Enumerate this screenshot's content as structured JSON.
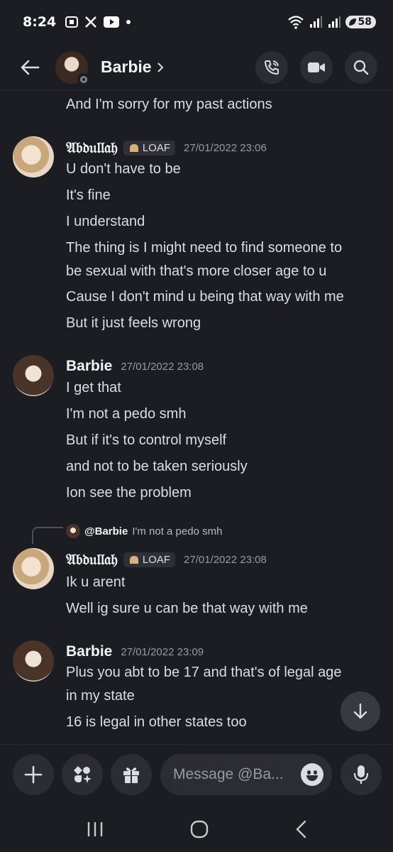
{
  "status_bar": {
    "time": "8:24",
    "battery": "58"
  },
  "header": {
    "contact_name": "Barbie"
  },
  "messages": {
    "prev_line": "And I'm sorry for my past actions",
    "group1": {
      "author": "𝔄𝔟𝔡𝔲𝔩𝔩𝔞𝔥",
      "tag": "LOAF",
      "timestamp": "27/01/2022 23:06",
      "lines": [
        "U don't have to be",
        "It's fine",
        "I understand",
        "The thing is I might need to find someone to",
        "be sexual with that's more closer age to u",
        "Cause I don't mind u being that way with me",
        "But it just feels wrong"
      ]
    },
    "group2": {
      "author": "Barbie",
      "timestamp": "27/01/2022 23:08",
      "lines": [
        "I get that",
        "I'm not a pedo smh",
        "But if it's to control myself",
        "and not to be taken seriously",
        "Ion see the problem"
      ]
    },
    "reply": {
      "name": "@Barbie",
      "text": "I'm not a pedo smh"
    },
    "group3": {
      "author": "𝔄𝔟𝔡𝔲𝔩𝔩𝔞𝔥",
      "tag": "LOAF",
      "timestamp": "27/01/2022 23:08",
      "lines": [
        "Ik u arent",
        "Well ig sure u can be that way with me"
      ]
    },
    "group4": {
      "author": "Barbie",
      "timestamp": "27/01/2022 23:09",
      "lines": [
        "Plus you abt to be 17 and that's of legal age",
        "in my state",
        "16 is legal in other states too"
      ]
    }
  },
  "composer": {
    "placeholder": "Message @Ba..."
  },
  "colors": {
    "background": "#1c1d22",
    "button": "#2b2d33",
    "timestamp": "#949ba4",
    "text": "#dbdee1"
  }
}
